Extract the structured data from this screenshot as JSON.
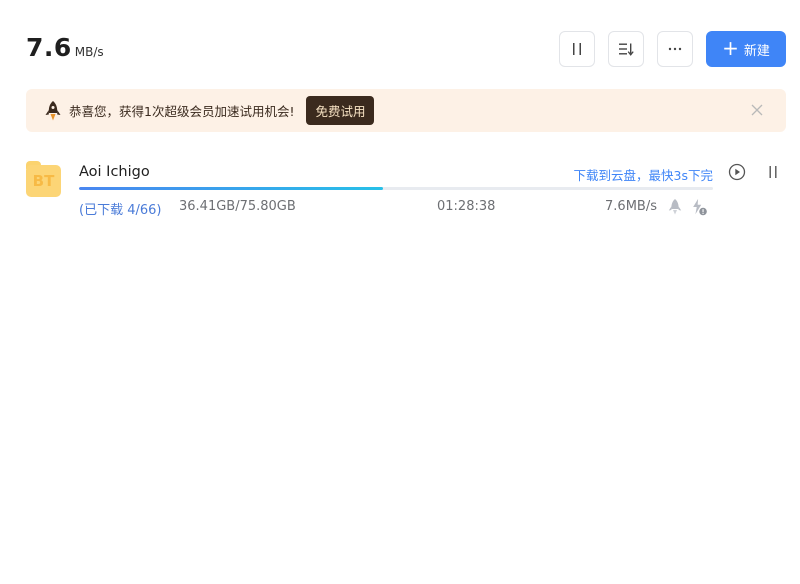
{
  "header": {
    "speed_value": "7.6",
    "speed_unit": "MB/s",
    "toolbar": [
      {
        "name": "pause-all",
        "icon": "pause-icon"
      },
      {
        "name": "sort",
        "icon": "sort-icon"
      },
      {
        "name": "more",
        "icon": "more-icon"
      }
    ],
    "new_label": "新建",
    "accent": "#3f85f7"
  },
  "banner": {
    "message": "恭喜您，获得1次超级会员加速试用机会!",
    "trial_label": "免费试用",
    "background": "#fdf1e6"
  },
  "tasks": [
    {
      "icon_label": "BT",
      "name": "Aoi Ichigo",
      "cloud_link": "下载到云盘，最快3s下完",
      "progress": 0.48,
      "files_status": "(已下载 4/66)",
      "size": "36.41GB/75.80GB",
      "remaining": "01:28:38",
      "rate": "7.6MB/s"
    }
  ]
}
